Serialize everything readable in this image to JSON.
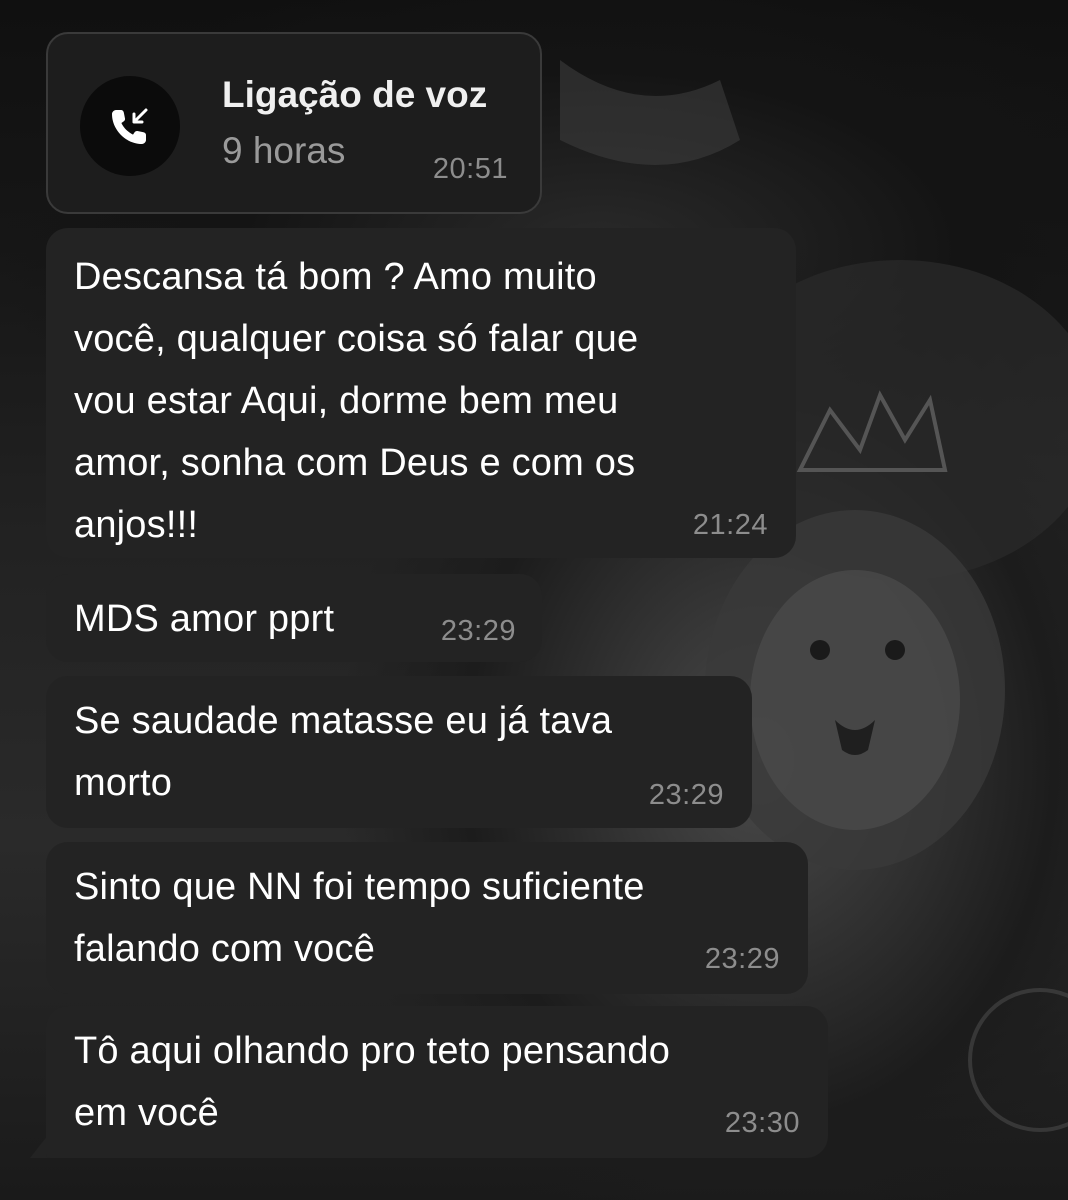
{
  "call": {
    "title": "Ligação de voz",
    "duration": "9 horas",
    "time": "20:51",
    "icon": "incoming-call-icon"
  },
  "messages": [
    {
      "lines": [
        "Descansa tá bom ? Amo muito",
        "você, qualquer coisa só falar que",
        "vou estar Aqui, dorme bem meu",
        "amor, sonha com Deus e com os",
        "anjos!!!"
      ],
      "time": "21:24"
    },
    {
      "lines": [
        "MDS amor pprt"
      ],
      "time": "23:29"
    },
    {
      "lines": [
        "Se saudade matasse eu já tava",
        "morto"
      ],
      "time": "23:29"
    },
    {
      "lines": [
        "Sinto que NN foi tempo suficiente",
        "falando com você"
      ],
      "time": "23:29"
    },
    {
      "lines": [
        "Tô aqui olhando pro teto pensando",
        "em você"
      ],
      "time": "23:30"
    }
  ],
  "theme": {
    "bubble_color": "#232323",
    "text_color": "#ffffff",
    "time_color": "#8d8d8d"
  }
}
